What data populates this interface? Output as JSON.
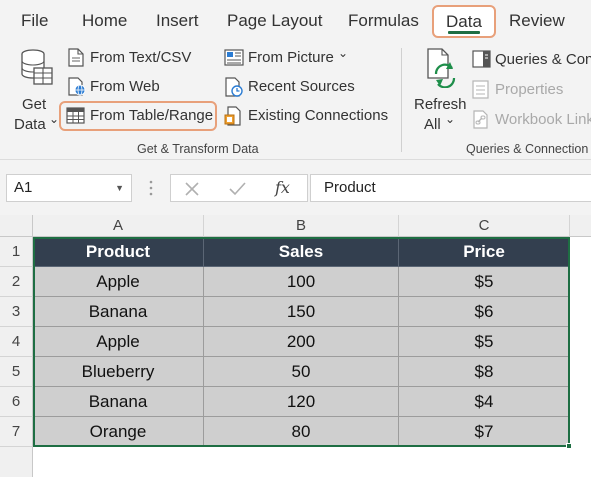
{
  "menu": {
    "tabs": [
      {
        "label": "File"
      },
      {
        "label": "Home"
      },
      {
        "label": "Insert"
      },
      {
        "label": "Page Layout"
      },
      {
        "label": "Formulas"
      },
      {
        "label": "Data",
        "active": true
      },
      {
        "label": "Review"
      }
    ]
  },
  "ribbon": {
    "get_data": {
      "line1": "Get",
      "line2": "Data",
      "chevron": "⌄"
    },
    "from_text_csv": "From Text/CSV",
    "from_web": "From Web",
    "from_table_range": "From Table/Range",
    "from_picture": "From Picture",
    "from_picture_chevron": "⌄",
    "recent_sources": "Recent Sources",
    "existing_connections": "Existing Connections",
    "group1_label": "Get & Transform Data",
    "refresh": {
      "line1": "Refresh",
      "line2": "All",
      "chevron": "⌄"
    },
    "queries_connections": "Queries & Con",
    "properties": "Properties",
    "workbook_links": "Workbook Link",
    "group2_label": "Queries & Connection"
  },
  "formula_bar": {
    "name_box": "A1",
    "fx": "fx",
    "content": "Product"
  },
  "sheet": {
    "columns": [
      "A",
      "B",
      "C"
    ],
    "rows": [
      "1",
      "2",
      "3",
      "4",
      "5",
      "6",
      "7"
    ],
    "header": [
      "Product",
      "Sales",
      "Price"
    ],
    "data": [
      [
        "Apple",
        "100",
        "$5"
      ],
      [
        "Banana",
        "150",
        "$6"
      ],
      [
        "Apple",
        "200",
        "$5"
      ],
      [
        "Blueberry",
        "50",
        "$8"
      ],
      [
        "Banana",
        "120",
        "$4"
      ],
      [
        "Orange",
        "80",
        "$7"
      ]
    ]
  },
  "colors": {
    "accent_green": "#1e6e43",
    "highlight_orange": "#e8a07a",
    "table_header": "#333f4f",
    "table_body": "#cfcfcf"
  }
}
